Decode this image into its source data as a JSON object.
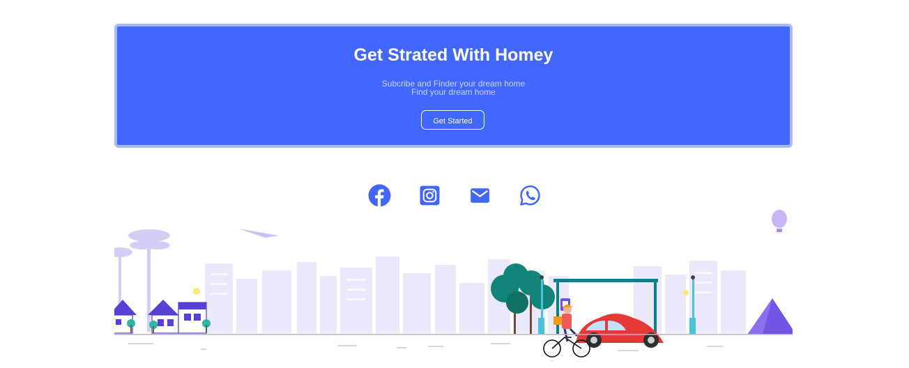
{
  "cta": {
    "title": "Get Strated With Homey",
    "subtitle_line1": "Subcribe and Finder your dream home",
    "subtitle_line2": "Find your dream home",
    "button_label": "Get Started"
  },
  "social": {
    "icons": [
      "facebook-icon",
      "instagram-icon",
      "email-icon",
      "whatsapp-icon"
    ],
    "color": "#4167ff"
  },
  "colors": {
    "brand_blue": "#4167ff",
    "border_blue": "#a9bbf7",
    "city_lilac": "#ebe8fb",
    "car_red": "#e53935",
    "tree_teal": "#128479"
  }
}
